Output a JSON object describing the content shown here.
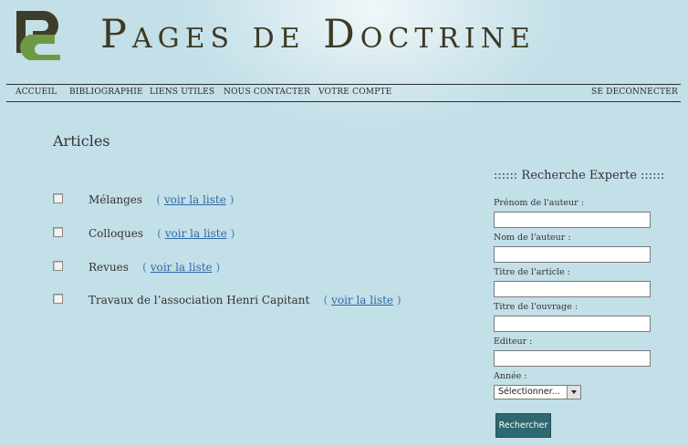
{
  "header": {
    "title": "Pages de Doctrine",
    "logo_icon": "pd-logo-icon",
    "colors": {
      "logo_dark": "#3d3d2a",
      "logo_green": "#6f9a45",
      "title": "#3d3a24"
    }
  },
  "nav": {
    "items": [
      {
        "label": "ACCUEIL"
      },
      {
        "label": "BIBLIOGRAPHIE"
      },
      {
        "label": "LIENS UTILES"
      },
      {
        "label": "NOUS CONTACTER"
      },
      {
        "label": "VOTRE COMPTE"
      }
    ],
    "logout_label": "SE DECONNECTER"
  },
  "main": {
    "section_title": "Articles",
    "articles": [
      {
        "label": "Mélanges",
        "link_label": "voir la liste"
      },
      {
        "label": "Colloques",
        "link_label": "voir la liste"
      },
      {
        "label": "Revues",
        "link_label": "voir la liste"
      },
      {
        "label": "Travaux de l’association Henri Capitant",
        "link_label": "voir la liste"
      }
    ],
    "paren_open": "(",
    "paren_close": ")"
  },
  "search": {
    "title": ":::::: Recherche Experte ::::::",
    "fields": [
      {
        "label": "Prénom de l'auteur :",
        "value": ""
      },
      {
        "label": "Nom de l'auteur :",
        "value": ""
      },
      {
        "label": "Titre de l'article :",
        "value": ""
      },
      {
        "label": "Titre de l'ouvrage :",
        "value": ""
      },
      {
        "label": "Editeur :",
        "value": ""
      }
    ],
    "year_label": "Année :",
    "year_selected": "Sélectionner...",
    "submit_label": "Rechercher",
    "colors": {
      "button_bg": "#2e6870"
    }
  },
  "theme": {
    "background": "#c3dfe8",
    "link": "#2f6aa3"
  }
}
